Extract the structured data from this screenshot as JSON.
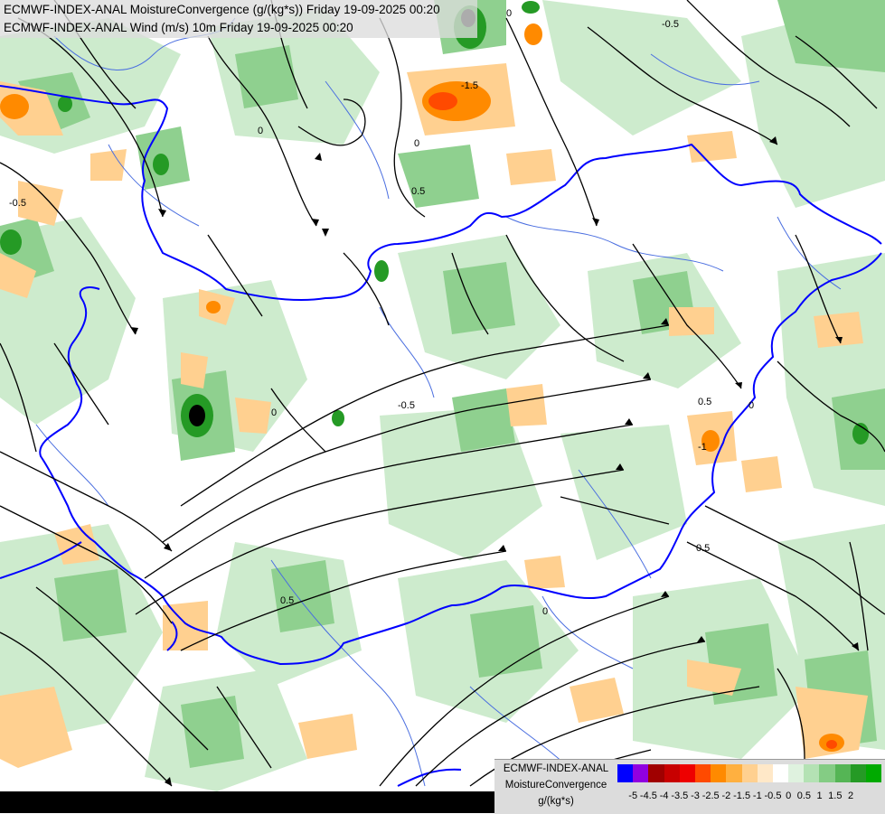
{
  "header": {
    "line1": "ECMWF-INDEX-ANAL MoistureConvergence (g/(kg*s)) Friday 19-09-2025 00:20",
    "line2": "ECMWF-INDEX-ANAL Wind (m/s) 10m Friday 19-09-2025 00:20"
  },
  "legend": {
    "line1": "ECMWF-INDEX-ANAL",
    "line2": "MoistureConvergence",
    "line3": "g/(kg*s)",
    "colors": [
      "#0000ff",
      "#9000e0",
      "#a00000",
      "#c80000",
      "#ee0000",
      "#ff4a00",
      "#ff8a00",
      "#ffb040",
      "#ffd090",
      "#ffe8c8",
      "#ffffff",
      "#dff2df",
      "#b4e2b4",
      "#84cc84",
      "#55b555",
      "#259a25",
      "#00aa00"
    ],
    "ticks": [
      "-5",
      "-4.5",
      "-4",
      "-3.5",
      "-3",
      "-2.5",
      "-2",
      "-1.5",
      "-1",
      "-0.5",
      "0",
      "0.5",
      "1",
      "1.5",
      "2"
    ]
  },
  "map_labels": [
    "0",
    "0.5",
    "-0.5",
    "0",
    "0",
    "-1",
    "0.5",
    "0",
    "-0.5",
    "-1.5",
    "0.5",
    "0",
    "-0.5",
    "0.5",
    "0"
  ],
  "colors": {
    "border": "#0000ff",
    "river": "#4a6ee0",
    "streamline": "#000000",
    "convergence_strong": "#1f9a2a",
    "divergence": "#ffb040"
  }
}
